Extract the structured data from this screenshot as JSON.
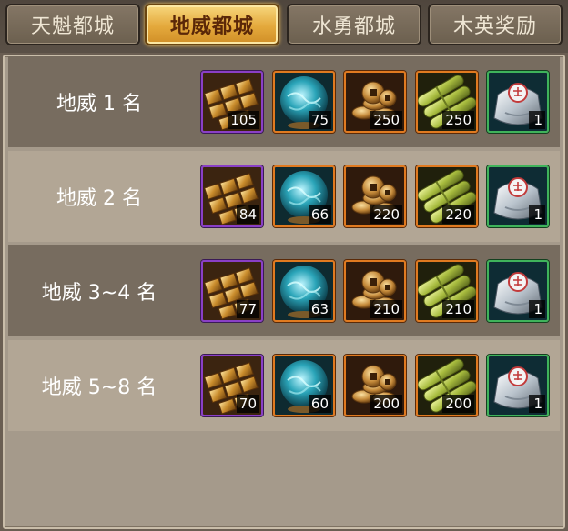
{
  "tabs": [
    {
      "label": "天魁都城",
      "active": false
    },
    {
      "label": "地威都城",
      "active": true
    },
    {
      "label": "水勇都城",
      "active": false
    },
    {
      "label": "木英奖励",
      "active": false
    }
  ],
  "rewards": [
    {
      "rank": "地威 1 名",
      "items": [
        {
          "icon": "gold-tiles-icon",
          "qty": "105",
          "rarity": "purple"
        },
        {
          "icon": "jade-orb-icon",
          "qty": "75",
          "rarity": "orange"
        },
        {
          "icon": "coins-icon",
          "qty": "250",
          "rarity": "orange"
        },
        {
          "icon": "bamboo-icon",
          "qty": "250",
          "rarity": "orange"
        },
        {
          "icon": "silver-bag-icon",
          "qty": "1",
          "rarity": "green"
        }
      ]
    },
    {
      "rank": "地威 2 名",
      "items": [
        {
          "icon": "gold-tiles-icon",
          "qty": "84",
          "rarity": "purple"
        },
        {
          "icon": "jade-orb-icon",
          "qty": "66",
          "rarity": "orange"
        },
        {
          "icon": "coins-icon",
          "qty": "220",
          "rarity": "orange"
        },
        {
          "icon": "bamboo-icon",
          "qty": "220",
          "rarity": "orange"
        },
        {
          "icon": "silver-bag-icon",
          "qty": "1",
          "rarity": "green"
        }
      ]
    },
    {
      "rank": "地威 3~4 名",
      "items": [
        {
          "icon": "gold-tiles-icon",
          "qty": "77",
          "rarity": "purple"
        },
        {
          "icon": "jade-orb-icon",
          "qty": "63",
          "rarity": "orange"
        },
        {
          "icon": "coins-icon",
          "qty": "210",
          "rarity": "orange"
        },
        {
          "icon": "bamboo-icon",
          "qty": "210",
          "rarity": "orange"
        },
        {
          "icon": "silver-bag-icon",
          "qty": "1",
          "rarity": "green"
        }
      ]
    },
    {
      "rank": "地威 5~8 名",
      "items": [
        {
          "icon": "gold-tiles-icon",
          "qty": "70",
          "rarity": "purple"
        },
        {
          "icon": "jade-orb-icon",
          "qty": "60",
          "rarity": "orange"
        },
        {
          "icon": "coins-icon",
          "qty": "200",
          "rarity": "orange"
        },
        {
          "icon": "bamboo-icon",
          "qty": "200",
          "rarity": "orange"
        },
        {
          "icon": "silver-bag-icon",
          "qty": "1",
          "rarity": "green"
        }
      ]
    }
  ]
}
